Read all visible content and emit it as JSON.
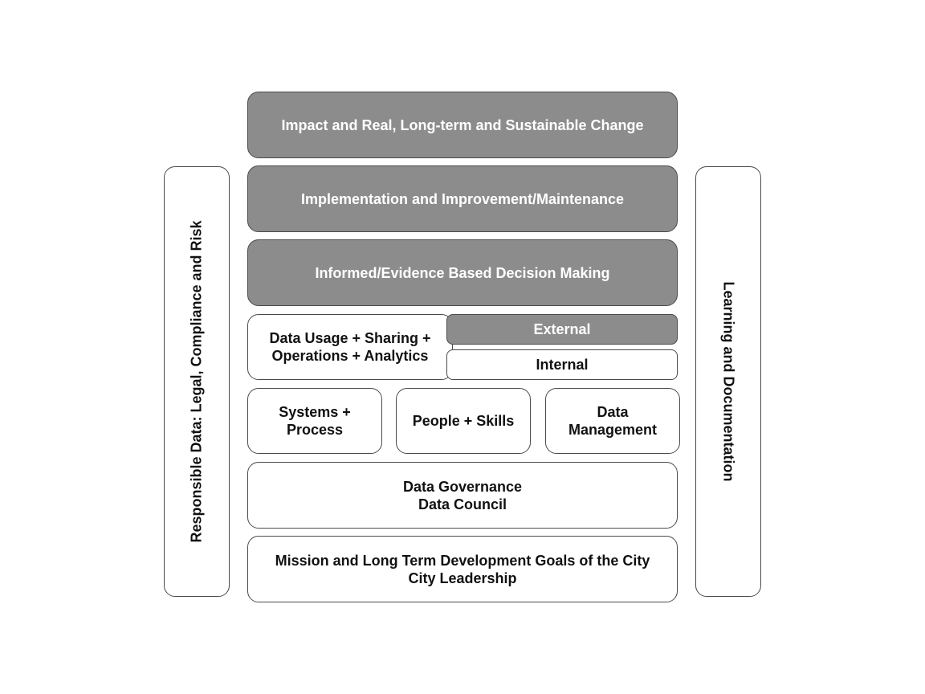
{
  "colors": {
    "dark_fill": "#8c8c8c",
    "light_fill": "#ffffff",
    "border": "#4a4a4a",
    "dark_text": "#ffffff",
    "light_text": "#111111"
  },
  "left_pillar": {
    "label": "Responsible Data: Legal, Compliance and Risk"
  },
  "right_pillar": {
    "label": "Learning and Documentation"
  },
  "tiers": {
    "impact": {
      "label": "Impact and Real, Long-term and Sustainable Change"
    },
    "implementation": {
      "label": "Implementation and Improvement/Maintenance"
    },
    "decision": {
      "label": "Informed/Evidence Based Decision Making"
    },
    "usage": {
      "label": "Data Usage + Sharing +\nOperations + Analytics",
      "external": "External",
      "internal": "Internal"
    },
    "enablers": {
      "systems": "Systems +\nProcess",
      "people": "People + Skills",
      "data_management": "Data\nManagement"
    },
    "governance": {
      "label": "Data Governance\nData Council"
    },
    "mission": {
      "label": "Mission and Long Term Development Goals of the City\nCity Leadership"
    }
  }
}
